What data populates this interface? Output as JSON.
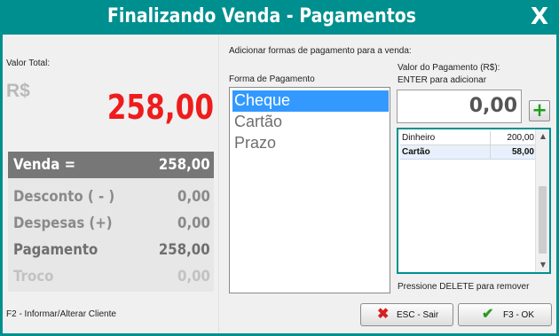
{
  "window": {
    "title": "Finalizando Venda - Pagamentos",
    "close_label": "X",
    "accent_color": "#008f8f"
  },
  "left": {
    "total_label": "Valor Total:",
    "currency": "R$",
    "total_value": "258,00",
    "total_color": "#ee1c1c",
    "summary": {
      "venda": {
        "label": "Venda =",
        "value": "258,00"
      },
      "desconto": {
        "label": "Desconto ( - )",
        "value": "0,00"
      },
      "despesas": {
        "label": "Despesas (+)",
        "value": "0,00"
      },
      "pagamento": {
        "label": "Pagamento",
        "value": "258,00"
      },
      "troco": {
        "label": "Troco",
        "value": "0,00"
      }
    },
    "f2_hint": "F2 - Informar/Alterar Cliente"
  },
  "right": {
    "add_hint": "Adicionar formas de pagamento para a venda:",
    "forma_label": "Forma de Pagamento",
    "forma_options": [
      "Cheque",
      "Cartão",
      "Prazo"
    ],
    "forma_selected": "Cheque",
    "valor_label_line1": "Valor do Pagamento (R$):",
    "valor_label_line2": "ENTER para adicionar",
    "valor_input": "0,00",
    "add_icon": "plus-icon",
    "payments": [
      {
        "name": "Dinheiro",
        "value": "200,00"
      },
      {
        "name": "Cartão",
        "value": "58,00"
      }
    ],
    "delete_hint": "Pressione DELETE para remover",
    "esc_button": "ESC - Sair",
    "esc_icon": "x-icon",
    "ok_button": "F3 - OK",
    "ok_icon": "check-icon"
  }
}
